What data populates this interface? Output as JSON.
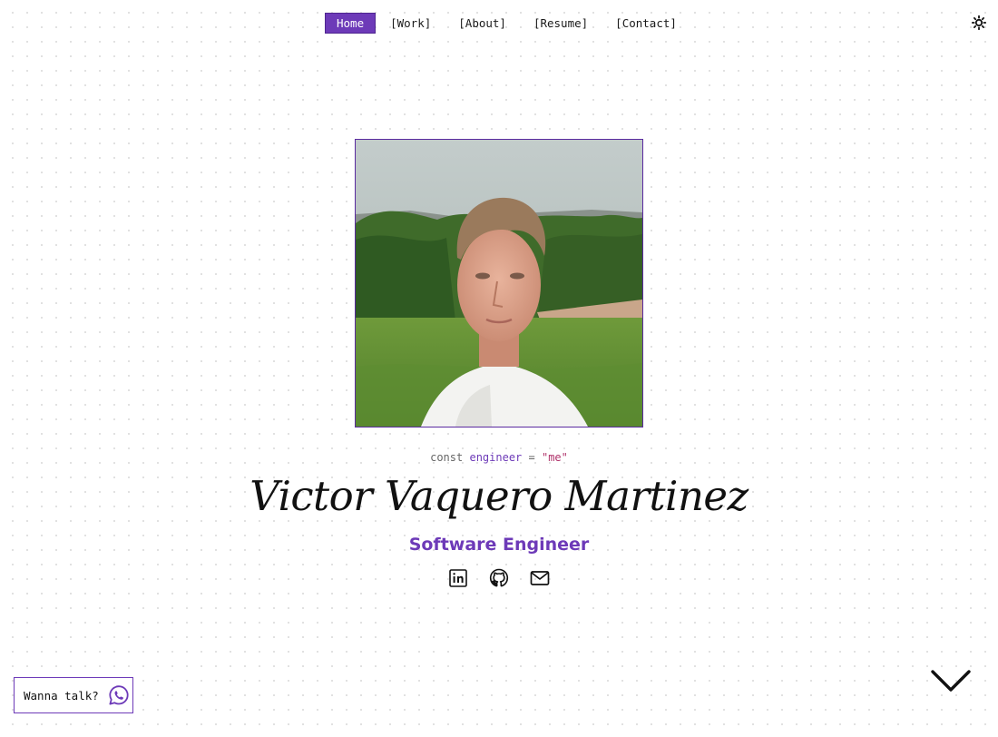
{
  "nav": {
    "items": [
      {
        "label": "Home",
        "active": true
      },
      {
        "label": "[Work]",
        "active": false
      },
      {
        "label": "[About]",
        "active": false
      },
      {
        "label": "[Resume]",
        "active": false
      },
      {
        "label": "[Contact]",
        "active": false
      }
    ],
    "theme_toggle_icon": "sun-icon"
  },
  "hero": {
    "photo_alt": "Portrait photo",
    "code": {
      "keyword": "const",
      "variable": "engineer",
      "operator": "=",
      "value": "\"me\""
    },
    "name": "Victor Vaquero Martinez",
    "role": "Software Engineer",
    "socials": [
      {
        "icon": "linkedin-icon"
      },
      {
        "icon": "github-icon"
      },
      {
        "icon": "mail-icon"
      }
    ]
  },
  "footer": {
    "talk_label": "Wanna talk?",
    "talk_icon": "whatsapp-icon",
    "scroll_icon": "chevron-down-icon"
  },
  "colors": {
    "accent": "#6d3ab8",
    "string": "#b0326a",
    "text": "#111111",
    "background": "#ffffff"
  }
}
